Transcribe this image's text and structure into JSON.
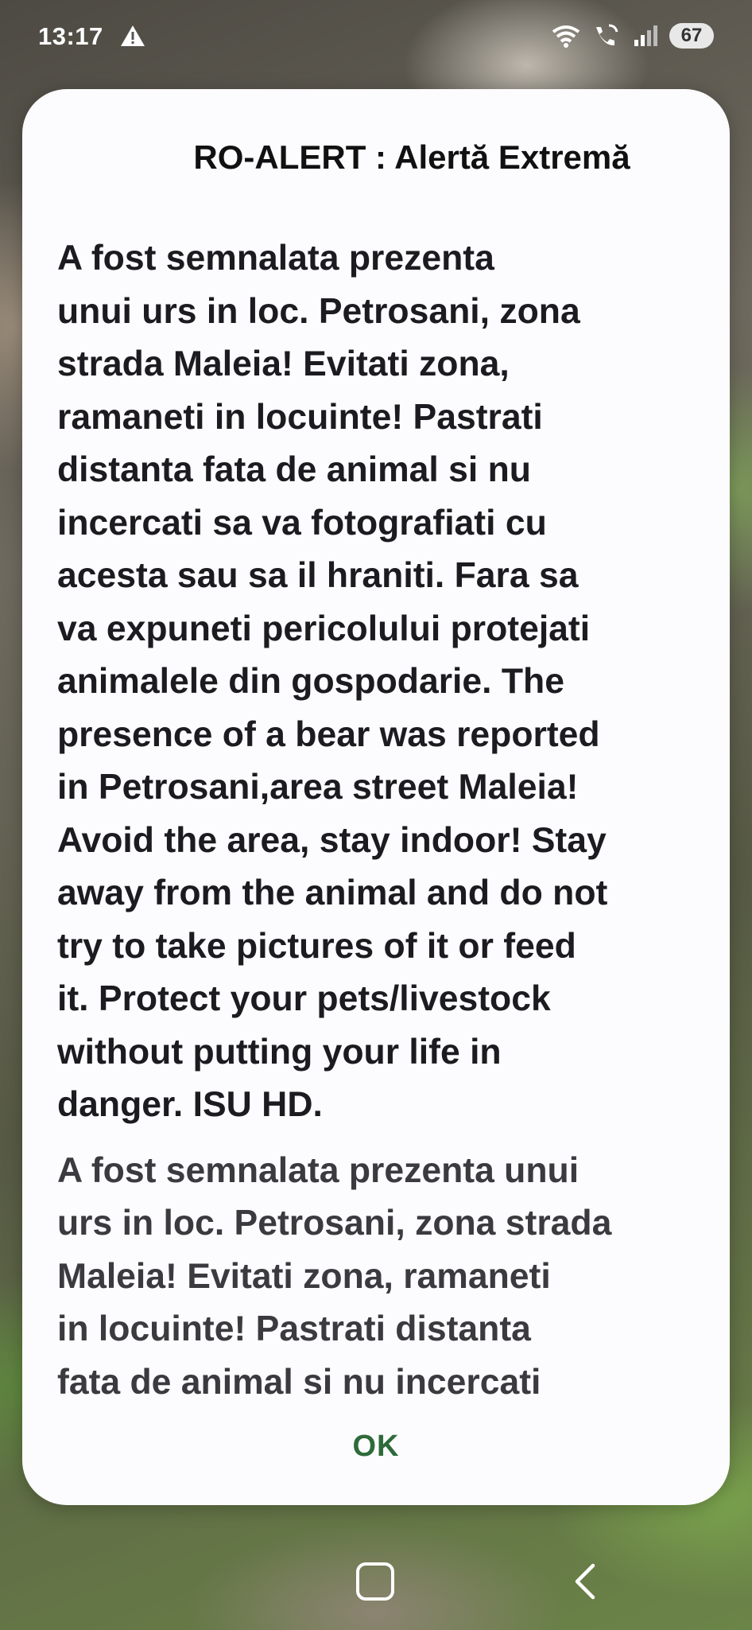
{
  "status_bar": {
    "time": "13:17",
    "warning_icon": "warning-triangle-icon",
    "battery": "67"
  },
  "dialog": {
    "title": "RO-ALERT : Alertă Extremă",
    "message_1": "A fost semnalata prezenta\nunui urs in loc. Petrosani, zona\nstrada Maleia! Evitati zona,\nramaneti in locuinte! Pastrati\ndistanta fata de animal si nu\nincercati sa va fotografiati cu\nacesta sau sa il hraniti. Fara sa\nva expuneti pericolului protejati\nanimalele din gospodarie. The\npresence of a bear was reported\nin Petrosani,area street Maleia!\nAvoid the area, stay indoor! Stay\naway from the animal and do not\ntry to take pictures of it or feed\nit. Protect your pets/livestock\nwithout putting your life in\ndanger. ISU HD.",
    "message_2": "A fost semnalata prezenta unui\nurs in loc. Petrosani, zona strada\nMaleia! Evitati zona, ramaneti\nin locuinte! Pastrati distanta\nfata de animal si nu incercati",
    "ok_label": "OK"
  },
  "colors": {
    "dialog_bg": "#fcfbfd",
    "ok_button": "#2e6b3a",
    "text": "#1c1b1f"
  }
}
